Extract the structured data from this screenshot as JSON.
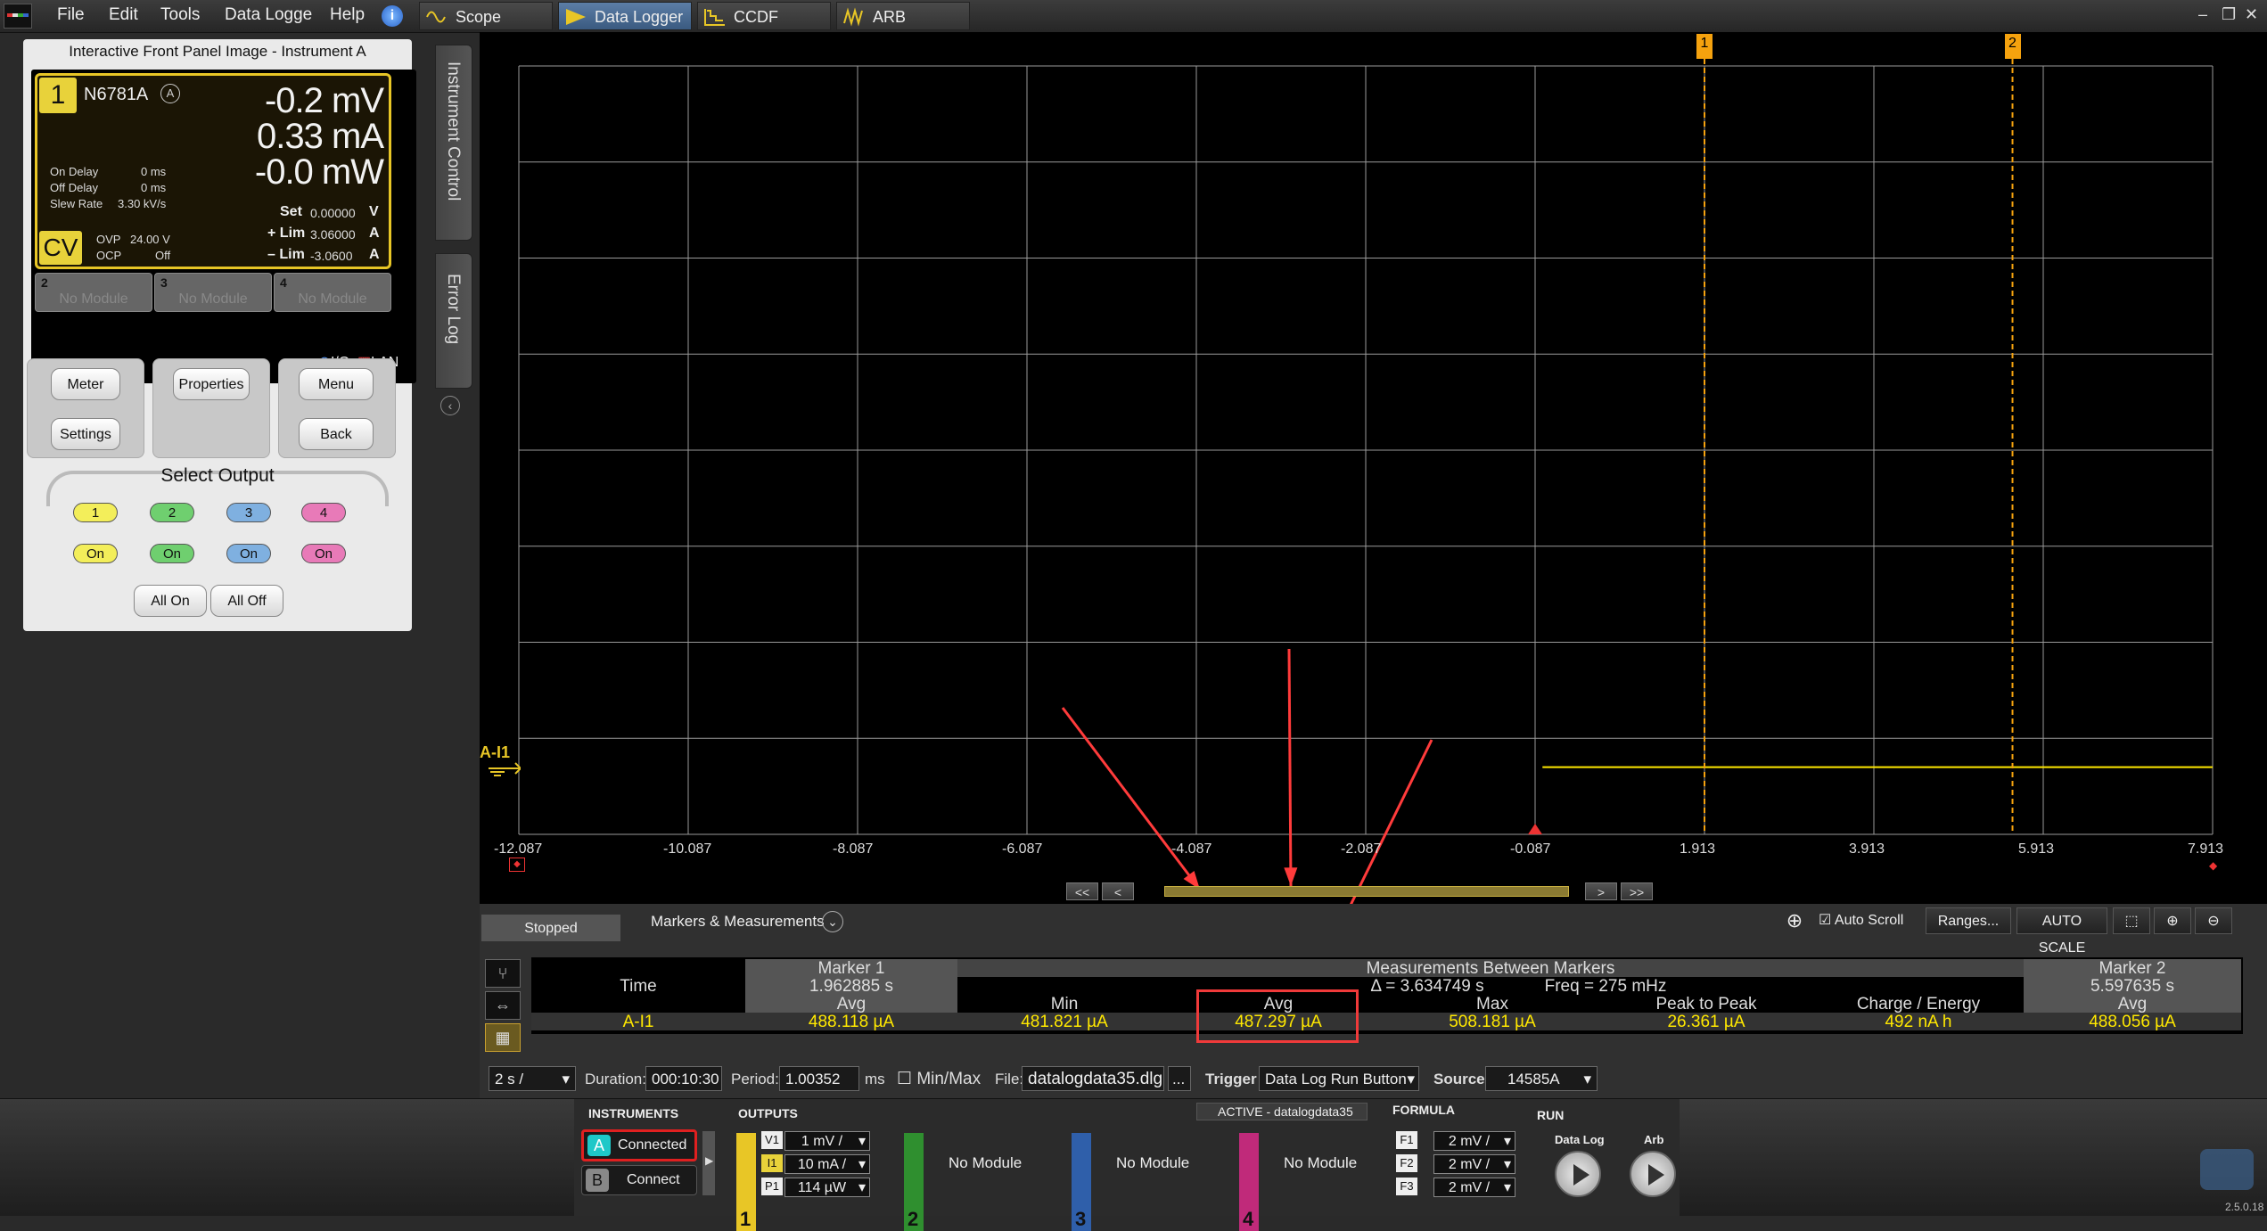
{
  "menu": [
    "File",
    "Edit",
    "Tools",
    "Data Logge",
    "Help"
  ],
  "tabs": [
    "Scope",
    "Data Logger",
    "CCDF",
    "ARB"
  ],
  "window_controls": [
    "–",
    "❐",
    "✕"
  ],
  "front_panel": {
    "title": "Interactive Front Panel Image - Instrument A",
    "channel": "1",
    "model": "N6781A",
    "badge": "A",
    "voltage": "-0.2 mV",
    "current": "0.33 mA",
    "power": "-0.0 mW",
    "on_delay_label": "On Delay",
    "on_delay": "0 ms",
    "off_delay_label": "Off Delay",
    "off_delay": "0 ms",
    "slew_label": "Slew Rate",
    "slew": "3.30 kV/s",
    "set_label": "Set",
    "set_value": "0.00000",
    "set_unit": "V",
    "plim_label": "+ Lim",
    "plim_value": "3.06000",
    "plim_unit": "A",
    "mlim_label": "– Lim",
    "mlim_value": "-3.0600",
    "mlim_unit": "A",
    "mode": "CV",
    "ovp_label": "OVP",
    "ovp": "24.00 V",
    "ocp_label": "OCP",
    "ocp": "Off",
    "modules": [
      {
        "num": "2",
        "label": "No Module"
      },
      {
        "num": "3",
        "label": "No Module"
      },
      {
        "num": "4",
        "label": "No Module"
      }
    ],
    "io": "I/O",
    "lan": "LAN",
    "buttons": {
      "meter": "Meter",
      "settings": "Settings",
      "properties": "Properties",
      "menu": "Menu",
      "back": "Back"
    },
    "select_output": "Select Output",
    "outputs": [
      "1",
      "2",
      "3",
      "4"
    ],
    "on_labels": [
      "On",
      "On",
      "On",
      "On"
    ],
    "all_on": "All On",
    "all_off": "All Off"
  },
  "side_tabs": {
    "instrument_control": "Instrument Control",
    "error_log": "Error Log"
  },
  "plot": {
    "x_ticks": [
      "-12.087",
      "-10.087",
      "-8.087",
      "-6.087",
      "-4.087",
      "-2.087",
      "-0.087",
      "1.913",
      "3.913",
      "5.913",
      "7.913"
    ],
    "trace_label": "A-I1",
    "marker1_label": "1",
    "marker2_label": "2",
    "marker1_x": 1.913,
    "marker2_x": 5.55,
    "trace_start_x": -0.0,
    "colors": {
      "trace": "#ffe800",
      "marker": "#f5a20e",
      "grid": "#9a9a9a",
      "arrow": "#ff3b3b"
    }
  },
  "nav": [
    "<<",
    "<",
    ">",
    ">>"
  ],
  "meas": {
    "status": "Stopped",
    "title": "Markers & Measurements",
    "auto_scroll": "Auto Scroll",
    "ranges": "Ranges...",
    "auto_scale": "AUTO SCALE",
    "marker1_hdr": "Marker 1",
    "marker2_hdr": "Marker 2",
    "between_hdr": "Measurements Between Markers",
    "time_label": "Time",
    "marker1_time": "1.962885 s",
    "marker2_time": "5.597635 s",
    "delta": "Δ = 3.634749 s",
    "freq": "Freq = 275 mHz",
    "avg_label": "Avg",
    "min_label": "Min",
    "max_label": "Max",
    "p2p_label": "Peak to Peak",
    "charge_label": "Charge / Energy",
    "channel": "A-I1",
    "m1_avg": "488.118 µA",
    "min": "481.821 µA",
    "avg": "487.297 µA",
    "max": "508.181 µA",
    "p2p": "26.361 µA",
    "charge": "492 nA h",
    "m2_avg": "488.056 µA"
  },
  "controls": {
    "timebase": "2 s /",
    "duration_label": "Duration:",
    "duration": "000:10:30",
    "period_label": "Period:",
    "period": "1.00352",
    "period_unit": "ms",
    "minmax": "Min/Max",
    "file_label": "File:",
    "file": "datalogdata35.dlg",
    "browse": "...",
    "trigger_label": "Trigger",
    "trigger": "Data Log Run Button",
    "source_label": "Source",
    "source": "14585A"
  },
  "bottom": {
    "instruments_label": "INSTRUMENTS",
    "outputs_label": "OUTPUTS",
    "active_label": "ACTIVE - datalogdata35",
    "formula_label": "FORMULA",
    "run_label": "RUN",
    "inst_a": "A",
    "inst_a_status": "Connected",
    "inst_b": "B",
    "inst_b_status": "Connect",
    "out1": {
      "num": "1",
      "v_tag": "V1",
      "v": "1 mV /",
      "i_tag": "I1",
      "i": "10 mA /",
      "p_tag": "P1",
      "p": "114 µW"
    },
    "out2": {
      "num": "2",
      "label": "No Module"
    },
    "out3": {
      "num": "3",
      "label": "No Module"
    },
    "out4": {
      "num": "4",
      "label": "No Module"
    },
    "formulas": [
      {
        "tag": "F1",
        "value": "2 mV /"
      },
      {
        "tag": "F2",
        "value": "2 mV /"
      },
      {
        "tag": "F3",
        "value": "2 mV /"
      }
    ],
    "datalog": "Data Log",
    "arb": "Arb",
    "version": "2.5.0.18",
    "colors": {
      "ch1": "#e8c626",
      "ch2": "#2f8f2f",
      "ch3": "#2f5faa",
      "ch4": "#c02a7a"
    }
  }
}
